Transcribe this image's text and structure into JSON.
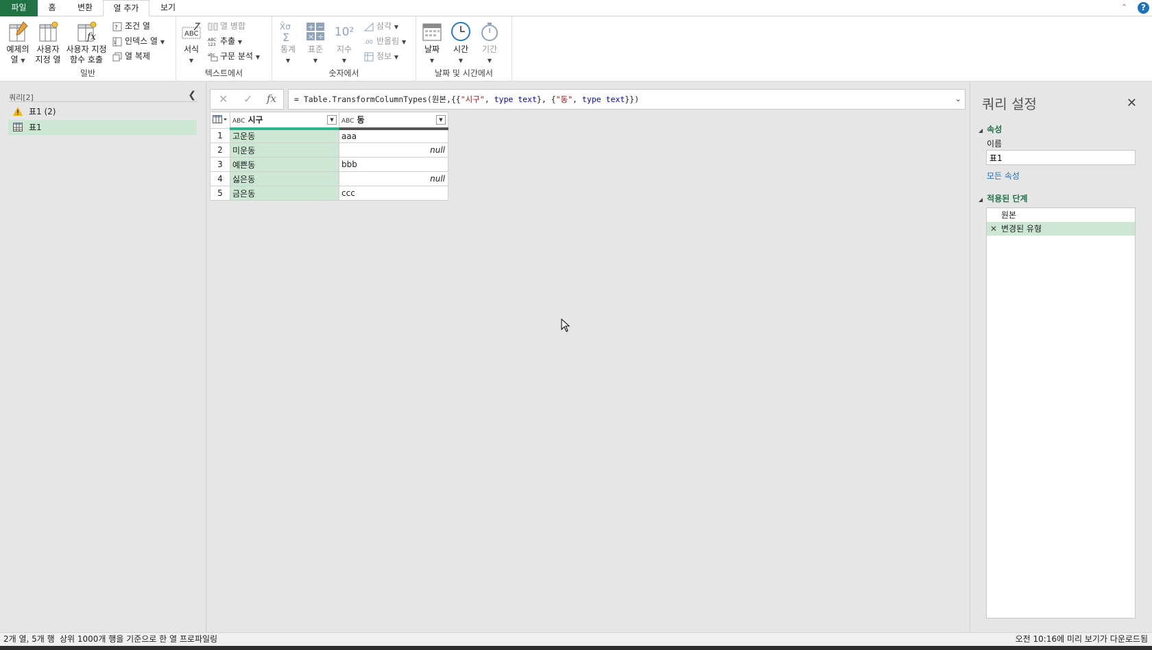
{
  "tabs": [
    {
      "label": "파일"
    },
    {
      "label": "홈"
    },
    {
      "label": "변환"
    },
    {
      "label": "열 추가"
    },
    {
      "label": "보기"
    }
  ],
  "ribbon": {
    "general": {
      "label": "일반",
      "example_col": [
        "예제의",
        "열"
      ],
      "custom_col": [
        "사용자",
        "지정 열"
      ],
      "invoke_fn": [
        "사용자 지정",
        "함수 호출"
      ],
      "cond_col": "조건 열",
      "index_col": "인덱스 열",
      "dup_col": "열 복제"
    },
    "text": {
      "label": "텍스트에서",
      "format": "서식",
      "merge": "열 병합",
      "extract": "추출",
      "parse": "구문 분석"
    },
    "number": {
      "label": "숫자에서",
      "stats": "통계",
      "standard": "표준",
      "scientific": "지수",
      "exponent_glyph": "10²",
      "trig": "삼각",
      "rounding": "반올림",
      "info": "정보"
    },
    "datetime": {
      "label": "날짜 및 시간에서",
      "date": "날짜",
      "time": "시간",
      "duration": "기간"
    }
  },
  "queries": {
    "header": "쿼리[2]",
    "items": [
      {
        "label": "표1 (2)",
        "icon": "warning-icon"
      },
      {
        "label": "표1",
        "icon": "table-icon"
      }
    ]
  },
  "formula": {
    "prefix": "= Table.TransformColumnTypes(원본,{{",
    "s1": "\"시구\"",
    "mid1": ", ",
    "kw1": "type text",
    "mid2": "}, {",
    "s2": "\"동\"",
    "mid3": ", ",
    "kw2": "type text",
    "suffix": "}})"
  },
  "grid": {
    "type_icon": "ABC",
    "columns": [
      "시구",
      "동"
    ],
    "rows": [
      {
        "n": "1",
        "a": "고운동",
        "b": "aaa"
      },
      {
        "n": "2",
        "a": "미운동",
        "b": "null"
      },
      {
        "n": "3",
        "a": "예쁜동",
        "b": "bbb"
      },
      {
        "n": "4",
        "a": "싫은동",
        "b": "null"
      },
      {
        "n": "5",
        "a": "금은동",
        "b": "ccc"
      }
    ]
  },
  "settings": {
    "title": "쿼리 설정",
    "properties_label": "속성",
    "name_label": "이름",
    "name_value": "표1",
    "all_properties": "모든 속성",
    "steps_label": "적용된 단계",
    "steps": [
      "원본",
      "변경된 유형"
    ]
  },
  "status": {
    "left": "2개 열, 5개 행",
    "middle": "상위 1000개 행을 기준으로 한 열 프로파일링",
    "right": "오전 10:16에 미리 보기가 다운로드됨"
  },
  "colors": {
    "accent": "#217346",
    "selection": "#cce8d4",
    "quality_bar": "#2bb58a"
  }
}
